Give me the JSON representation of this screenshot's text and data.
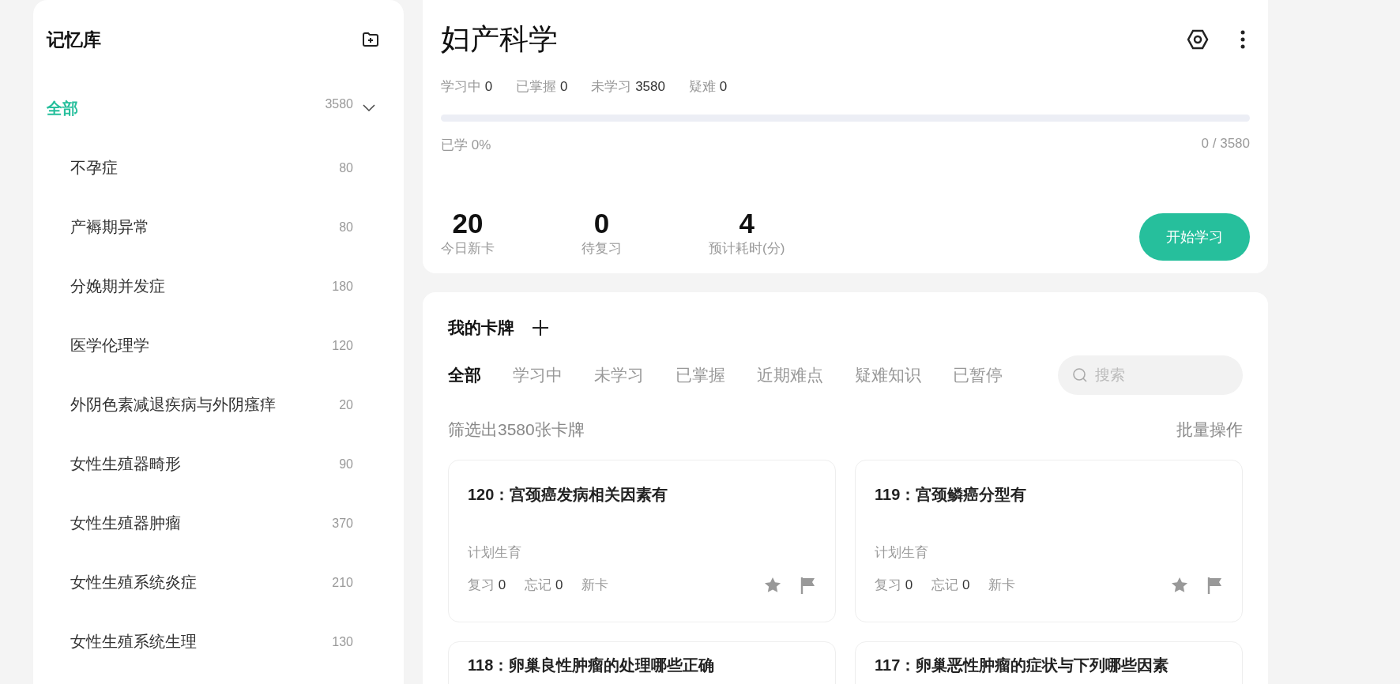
{
  "sidebar": {
    "title": "记忆库",
    "root": {
      "label": "全部",
      "count": "3580",
      "selected": true,
      "expanded": true,
      "children": [
        {
          "label": "不孕症",
          "count": "80",
          "selected": false
        },
        {
          "label": "产褥期异常",
          "count": "80",
          "selected": false
        },
        {
          "label": "分娩期并发症",
          "count": "180",
          "selected": false
        },
        {
          "label": "医学伦理学",
          "count": "120",
          "selected": false
        },
        {
          "label": "外阴色素减退疾病与外阴瘙痒",
          "count": "20",
          "selected": false
        },
        {
          "label": "女性生殖器畸形",
          "count": "90",
          "selected": false
        },
        {
          "label": "女性生殖器肿瘤",
          "count": "370",
          "selected": false
        },
        {
          "label": "女性生殖系统炎症",
          "count": "210",
          "selected": false
        },
        {
          "label": "女性生殖系统生理",
          "count": "130",
          "selected": false
        }
      ]
    }
  },
  "deck": {
    "title": "妇产科学",
    "stats": [
      {
        "label": "学习中",
        "value": "0"
      },
      {
        "label": "已掌握",
        "value": "0"
      },
      {
        "label": "未学习",
        "value": "3580"
      },
      {
        "label": "疑难",
        "value": "0"
      }
    ],
    "progress": {
      "level": 0,
      "label": "已学 0%",
      "reading": "0 / 3580"
    },
    "figures": [
      {
        "value": "20",
        "label": "今日新卡"
      },
      {
        "value": "0",
        "label": "待复习"
      },
      {
        "value": "4",
        "label": "预计耗时(分)"
      }
    ],
    "start_button": "开始学习"
  },
  "cards_section": {
    "title": "我的卡牌",
    "tabs": [
      {
        "label": "全部",
        "selected": true
      },
      {
        "label": "学习中",
        "selected": false
      },
      {
        "label": "未学习",
        "selected": false
      },
      {
        "label": "已掌握",
        "selected": false
      },
      {
        "label": "近期难点",
        "selected": false
      },
      {
        "label": "疑难知识",
        "selected": false
      },
      {
        "label": "已暂停",
        "selected": false
      }
    ],
    "search": {
      "placeholder": "搜索"
    },
    "filter_text": "筛选出3580张卡牌",
    "batch_action": "批量操作",
    "cards": [
      {
        "title": "120：宫颈癌发病相关因素有",
        "tag": "计划生育",
        "review_label": "复习",
        "review": "0",
        "forget_label": "忘记",
        "forget": "0",
        "status": "新卡",
        "starred": false,
        "flagged": false
      },
      {
        "title": "119：宫颈鳞癌分型有",
        "tag": "计划生育",
        "review_label": "复习",
        "review": "0",
        "forget_label": "忘记",
        "forget": "0",
        "status": "新卡",
        "starred": false,
        "flagged": false
      },
      {
        "title": "118：卵巢良性肿瘤的处理哪些正确"
      },
      {
        "title": "117：卵巢恶性肿瘤的症状与下列哪些因素"
      }
    ]
  }
}
